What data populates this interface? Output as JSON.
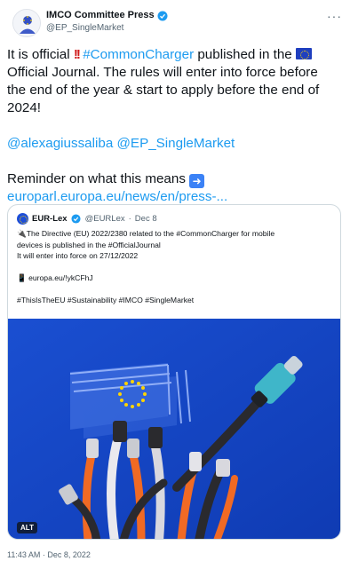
{
  "author": {
    "name": "IMCO Committee Press",
    "handle": "@EP_SingleMarket"
  },
  "tweet": {
    "line1_pre": "It is official ",
    "line1_hashtag": "#CommonCharger",
    "line1_post": " published in the ",
    "line2": "Official Journal. The rules will enter into force before",
    "line3": "the end of the year & start to apply before the end of",
    "line4": "2024!",
    "mention1": "@alexagiussaliba",
    "mention2": "@EP_SingleMarket",
    "reminder": "Reminder on what this means ",
    "link": "europarl.europa.eu/news/en/press-..."
  },
  "quote": {
    "name": "EUR-Lex",
    "handle": "@EURLex",
    "date": "Dec 8",
    "line1": "The Directive (EU) 2022/2380 related to the #CommonCharger for mobile",
    "line2": "devices is published in the #OfficialJournal",
    "line3": "It will enter into force on 27/12/2022",
    "link": "europa.eu/!ykCFhJ",
    "hashtags": "#ThisIsTheEU #Sustainability #IMCO #SingleMarket",
    "alt_label": "ALT"
  },
  "timestamp": "11:43 AM · Dec 8, 2022",
  "colors": {
    "link": "#1d9bf0",
    "verified": "#1d9bf0",
    "image_bg": "#1a4fd1",
    "usb_c_head": "#3fb6c9"
  },
  "icons": {
    "verified": "verified-badge-icon",
    "more": "more-options-icon",
    "flag": "eu-flag-icon",
    "arrow": "right-arrow-emoji-icon",
    "phone": "mobile-phone-icon"
  }
}
